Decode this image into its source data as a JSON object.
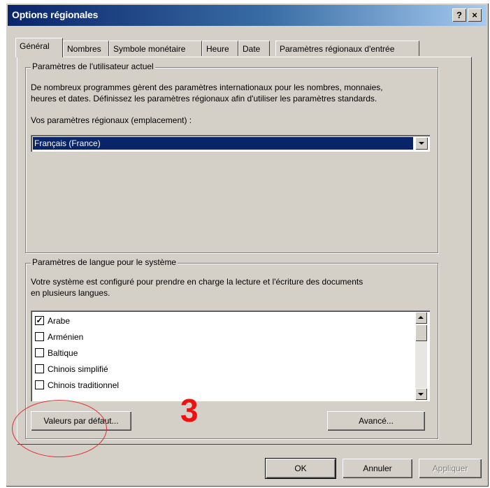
{
  "window": {
    "title": "Options régionales",
    "help_button": "?",
    "close_button": "×"
  },
  "tabs": [
    {
      "label": "Général",
      "active": true
    },
    {
      "label": "Nombres",
      "active": false
    },
    {
      "label": "Symbole monétaire",
      "active": false
    },
    {
      "label": "Heure",
      "active": false
    },
    {
      "label": "Date",
      "active": false
    },
    {
      "label": "Paramètres régionaux d'entrée",
      "active": false
    }
  ],
  "user_settings": {
    "title": "Paramètres de l'utilisateur actuel",
    "description_line1": "De nombreux programmes gèrent des paramètres internationaux pour les nombres, monnaies,",
    "description_line2": "heures et dates. Définissez les paramètres régionaux afin d'utiliser les paramètres standards.",
    "locale_label": "Vos paramètres régionaux (emplacement) :",
    "locale_value": "Français (France)"
  },
  "language_settings": {
    "title": "Paramètres de langue pour le système",
    "description_line1": "Votre système est configuré pour prendre en charge la lecture et l'écriture des documents",
    "description_line2": "en plusieurs langues.",
    "languages": [
      {
        "label": "Arabe",
        "checked": true
      },
      {
        "label": "Arménien",
        "checked": false
      },
      {
        "label": "Baltique",
        "checked": false
      },
      {
        "label": "Chinois simplifié",
        "checked": false
      },
      {
        "label": "Chinois traditionnel",
        "checked": false
      }
    ],
    "defaults_button": "Valeurs par défaut...",
    "advanced_button": "Avancé..."
  },
  "annotation": {
    "step_number": "3",
    "highlight_color": "#e03030"
  },
  "footer": {
    "ok": "OK",
    "cancel": "Annuler",
    "apply": "Appliquer"
  },
  "colors": {
    "title_bar_start": "#0a246a",
    "title_bar_end": "#a6caf0",
    "selection": "#0a246a",
    "dialog_face": "#d4d0c8"
  }
}
